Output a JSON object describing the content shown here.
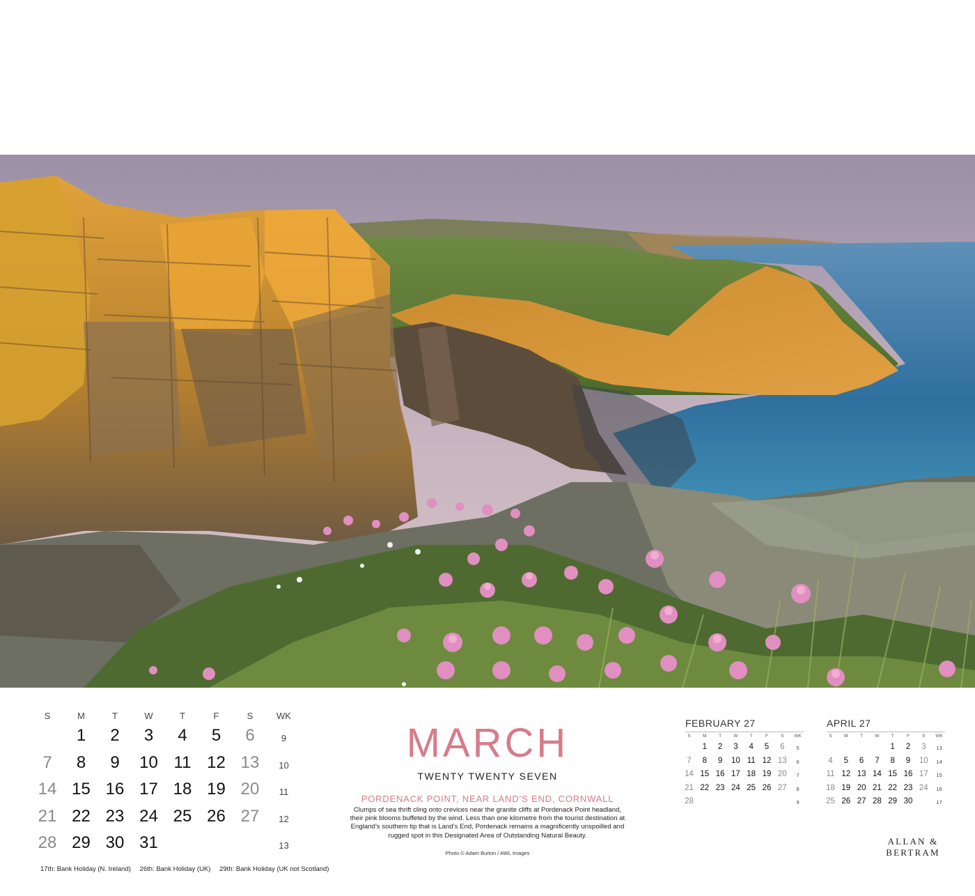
{
  "main_calendar": {
    "headers": [
      "S",
      "M",
      "T",
      "W",
      "T",
      "F",
      "S",
      "WK"
    ],
    "weeks": [
      {
        "days": [
          "",
          "1",
          "2",
          "3",
          "4",
          "5",
          "6"
        ],
        "wk": "9"
      },
      {
        "days": [
          "7",
          "8",
          "9",
          "10",
          "11",
          "12",
          "13"
        ],
        "wk": "10"
      },
      {
        "days": [
          "14",
          "15",
          "16",
          "17",
          "18",
          "19",
          "20"
        ],
        "wk": "11"
      },
      {
        "days": [
          "21",
          "22",
          "23",
          "24",
          "25",
          "26",
          "27"
        ],
        "wk": "12"
      },
      {
        "days": [
          "28",
          "29",
          "30",
          "31",
          "",
          "",
          ""
        ],
        "wk": "13"
      }
    ],
    "holidays": [
      "17th: Bank Holiday (N. Ireland)",
      "26th: Bank Holiday (UK)",
      "29th: Bank Holiday (UK not Scotland)"
    ]
  },
  "month": {
    "name": "MARCH",
    "year_text": "TWENTY TWENTY SEVEN"
  },
  "caption": {
    "title": "PORDENACK POINT, NEAR LAND’S END, CORNWALL",
    "body": "Clumps of sea thrift cling onto crevices near the granite cliffs at Pordenack Point headland, their pink blooms buffeted by the wind. Less than one kilometre from the tourist destination at England’s southern tip that is Land’s End, Pordenack remains a magnificently unspoilled and rugged spot in this Designated Area of Outstanding Natural Beauty.",
    "credit": "Photo © Adam Burton / AWL Images"
  },
  "mini_calendars": [
    {
      "title": "FEBRUARY 27",
      "headers": [
        "S",
        "M",
        "T",
        "W",
        "T",
        "F",
        "S",
        "WK"
      ],
      "weeks": [
        {
          "days": [
            "",
            "1",
            "2",
            "3",
            "4",
            "5",
            "6"
          ],
          "wk": "5"
        },
        {
          "days": [
            "7",
            "8",
            "9",
            "10",
            "11",
            "12",
            "13"
          ],
          "wk": "6"
        },
        {
          "days": [
            "14",
            "15",
            "16",
            "17",
            "18",
            "19",
            "20"
          ],
          "wk": "7"
        },
        {
          "days": [
            "21",
            "22",
            "23",
            "24",
            "25",
            "26",
            "27"
          ],
          "wk": "8"
        },
        {
          "days": [
            "28",
            "",
            "",
            "",
            "",
            "",
            ""
          ],
          "wk": "9"
        }
      ]
    },
    {
      "title": "APRIL 27",
      "headers": [
        "S",
        "M",
        "T",
        "W",
        "T",
        "F",
        "S",
        "WK"
      ],
      "weeks": [
        {
          "days": [
            "",
            "",
            "",
            "",
            "1",
            "2",
            "3"
          ],
          "wk": "13"
        },
        {
          "days": [
            "4",
            "5",
            "6",
            "7",
            "8",
            "9",
            "10"
          ],
          "wk": "14"
        },
        {
          "days": [
            "11",
            "12",
            "13",
            "14",
            "15",
            "16",
            "17"
          ],
          "wk": "15"
        },
        {
          "days": [
            "18",
            "19",
            "20",
            "21",
            "22",
            "23",
            "24"
          ],
          "wk": "16"
        },
        {
          "days": [
            "25",
            "26",
            "27",
            "28",
            "29",
            "30",
            ""
          ],
          "wk": "17"
        }
      ]
    }
  ],
  "brand": {
    "line1": "ALLAN &",
    "line2": "BERTRAM"
  },
  "colors": {
    "accent": "#d77b8a"
  }
}
